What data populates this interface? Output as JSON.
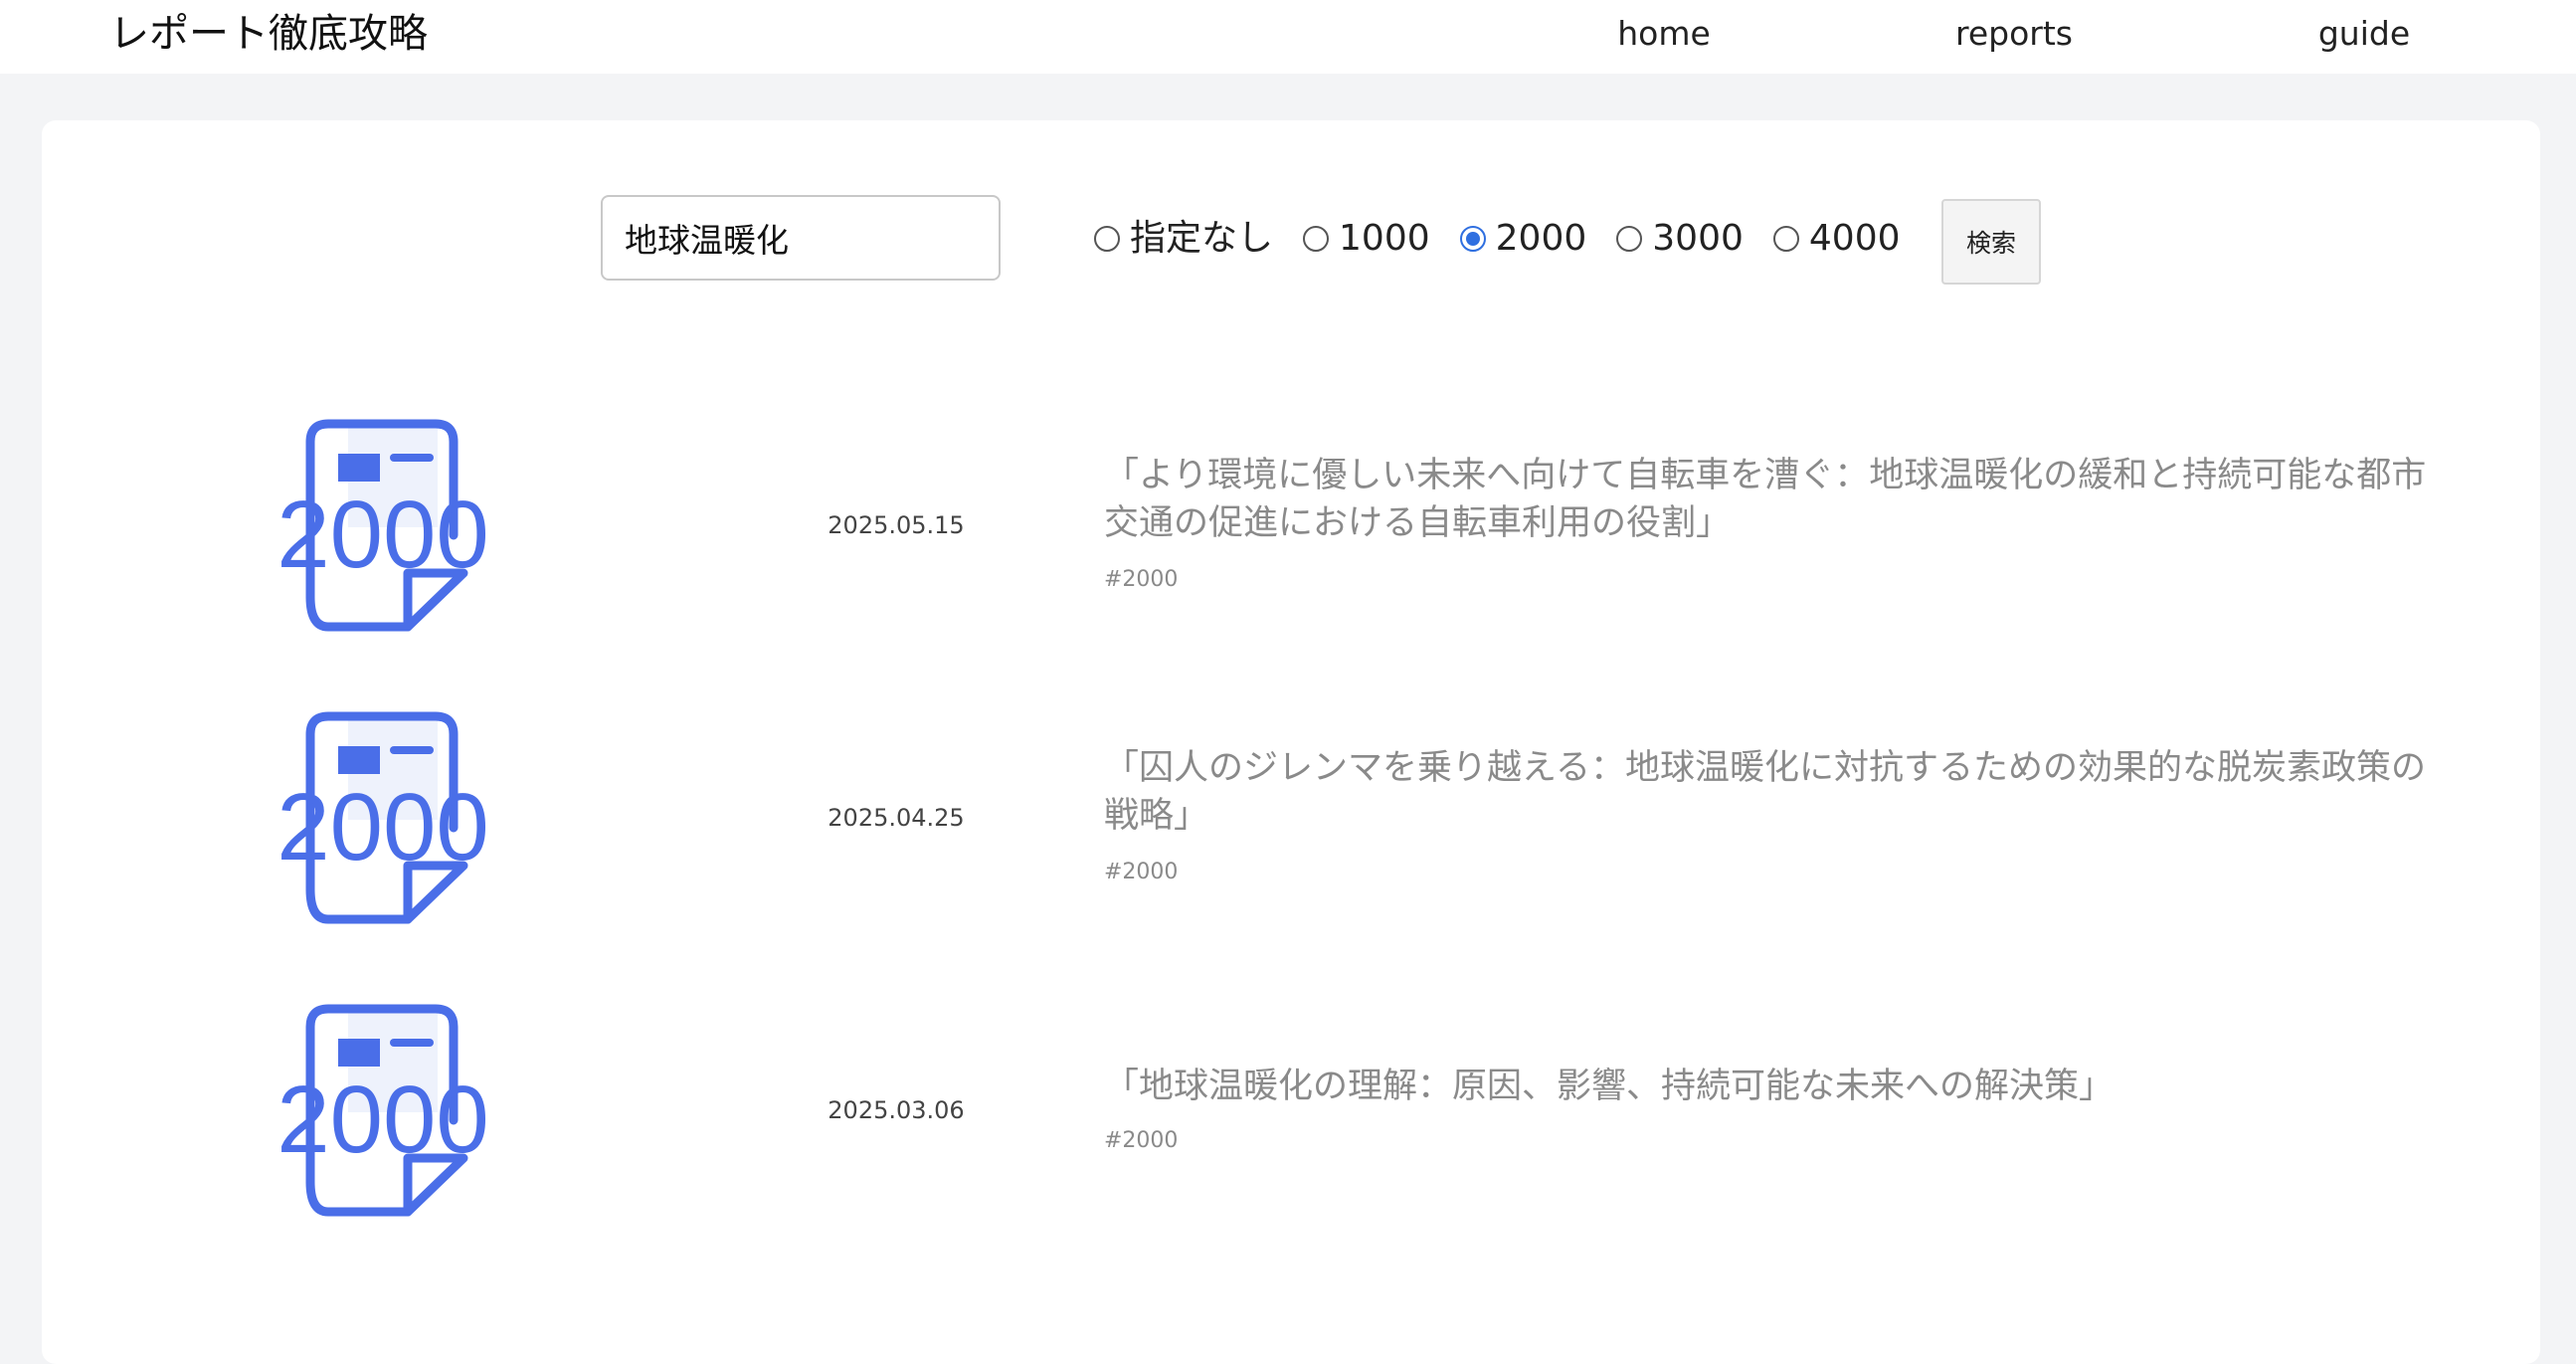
{
  "header": {
    "site_title": "レポート徹底攻略",
    "nav": [
      {
        "label": "home"
      },
      {
        "label": "reports"
      },
      {
        "label": "guide"
      }
    ]
  },
  "search": {
    "value": "地球温暖化",
    "placeholder": "",
    "button_label": "検索",
    "options": [
      {
        "label": "指定なし",
        "checked": false
      },
      {
        "label": "1000",
        "checked": false
      },
      {
        "label": "2000",
        "checked": true
      },
      {
        "label": "3000",
        "checked": false
      },
      {
        "label": "4000",
        "checked": false
      }
    ]
  },
  "reports": [
    {
      "thumb_label": "2000",
      "date": "2025.05.15",
      "title": "「より環境に優しい未来へ向けて自転車を漕ぐ：地球温暖化の緩和と持続可能な都市交通の促進における自転車利用の役割」",
      "tag": "#2000"
    },
    {
      "thumb_label": "2000",
      "date": "2025.04.25",
      "title": "「囚人のジレンマを乗り越える：地球温暖化に対抗するための効果的な脱炭素政策の戦略」",
      "tag": "#2000"
    },
    {
      "thumb_label": "2000",
      "date": "2025.03.06",
      "title": "「地球温暖化の理解：原因、影響、持続可能な未来への解決策」",
      "tag": "#2000"
    }
  ],
  "colors": {
    "accent": "#2f6fe0",
    "icon_blue": "#4a6ee8",
    "muted_text": "#8a8a8a",
    "page_bg": "#f3f4f6"
  },
  "icons": {
    "report_thumb": "document-icon"
  }
}
